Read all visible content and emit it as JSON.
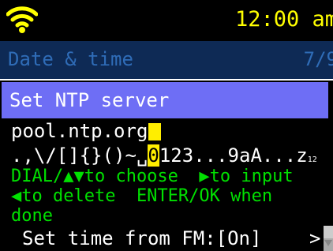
{
  "status": {
    "clock": "12:00 am",
    "wifi_icon": "wifi-icon",
    "accent": "#ffff00"
  },
  "menu": {
    "title": "Date & time",
    "page": "7/9"
  },
  "dialog": {
    "title": "Set NTP server",
    "value": "pool.ntp.org",
    "charset_prefix": ".,\\/[]{}()~␣",
    "charset_selected": "0",
    "charset_suffix": "123...9aA...z",
    "charset_tail": "12",
    "help_text": "DIAL/▲▼to choose  ▶to input\n◀to delete  ENTER/OK when\ndone"
  },
  "bottom_item": {
    "label": "Set time from FM:[On]",
    "arrow": ">"
  }
}
